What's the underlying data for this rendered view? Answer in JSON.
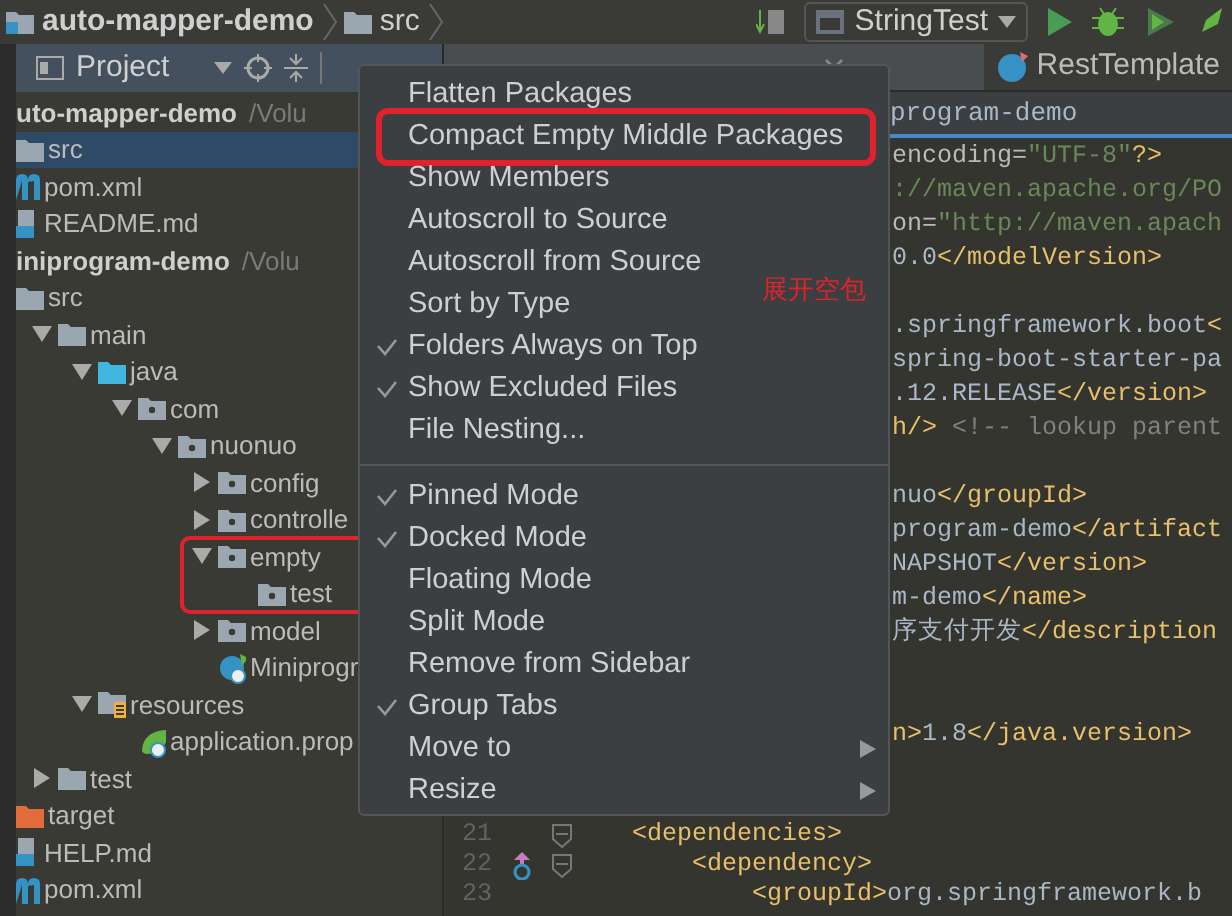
{
  "toolbar": {
    "breadcrumbs": [
      "auto-mapper-demo",
      "src"
    ],
    "run_configuration": "StringTest"
  },
  "tool_window": {
    "title": "Project",
    "tree": [
      {
        "label": "uto-mapper-demo",
        "kind": "module",
        "path": "/Volu",
        "selected": false,
        "expanded": true,
        "children": [
          {
            "label": "src",
            "kind": "folder",
            "selected": true
          },
          {
            "label": "pom.xml",
            "kind": "maven",
            "selected": false
          },
          {
            "label": "README.md",
            "kind": "markdown",
            "selected": false
          }
        ]
      },
      {
        "label": "iniprogram-demo",
        "kind": "module",
        "path": "/Volu",
        "selected": false,
        "expanded": true,
        "children": [
          {
            "label": "src",
            "kind": "folder",
            "selected": false,
            "expanded": true,
            "children": [
              {
                "label": "main",
                "kind": "folder",
                "selected": false,
                "expanded": true,
                "children": [
                  {
                    "label": "java",
                    "kind": "source",
                    "selected": false,
                    "expanded": true,
                    "children": [
                      {
                        "label": "com",
                        "kind": "package",
                        "selected": false,
                        "expanded": true,
                        "children": [
                          {
                            "label": "nuonuo",
                            "kind": "package",
                            "selected": false,
                            "expanded": true,
                            "children": [
                              {
                                "label": "config",
                                "kind": "package",
                                "selected": false,
                                "expanded": false
                              },
                              {
                                "label": "controlle",
                                "kind": "package",
                                "selected": false,
                                "expanded": false
                              },
                              {
                                "label": "empty",
                                "kind": "package",
                                "selected": false,
                                "expanded": true,
                                "annotated": true,
                                "children": [
                                  {
                                    "label": "test",
                                    "kind": "package",
                                    "selected": false
                                  }
                                ]
                              },
                              {
                                "label": "model",
                                "kind": "package",
                                "selected": false,
                                "expanded": false
                              },
                              {
                                "label": "Miniprogr",
                                "kind": "boot-class",
                                "selected": false
                              }
                            ]
                          }
                        ]
                      }
                    ]
                  },
                  {
                    "label": "resources",
                    "kind": "resources",
                    "selected": false,
                    "expanded": true,
                    "children": [
                      {
                        "label": "application.prop",
                        "kind": "properties",
                        "selected": false
                      }
                    ]
                  }
                ]
              },
              {
                "label": "test",
                "kind": "folder",
                "selected": false,
                "expanded": false
              }
            ]
          },
          {
            "label": "target",
            "kind": "excluded",
            "selected": false
          },
          {
            "label": "HELP.md",
            "kind": "markdown",
            "selected": false
          },
          {
            "label": "pom.xml",
            "kind": "maven",
            "selected": false
          }
        ]
      }
    ]
  },
  "editor": {
    "tabs": [
      {
        "selected": true,
        "closable": true
      },
      {
        "label": "RestTemplate",
        "selected": false,
        "closable": false
      }
    ],
    "breadcrumb": "program-demo",
    "lines": [
      {
        "kind": "partial",
        "segments": [
          {
            "text": "encoding=",
            "kind": "attr"
          },
          {
            "text": "\"UTF-8\"",
            "kind": "value"
          },
          {
            "text": "?>",
            "kind": "tag"
          }
        ]
      },
      {
        "kind": "partial",
        "segments": [
          {
            "text": "://maven.apache.org/PO",
            "kind": "value"
          }
        ]
      },
      {
        "kind": "partial",
        "segments": [
          {
            "text": "on=",
            "kind": "attr"
          },
          {
            "text": "\"http://maven.apach",
            "kind": "value"
          }
        ]
      },
      {
        "kind": "partial",
        "segments": [
          {
            "text": "0.0",
            "kind": "text"
          },
          {
            "text": "</modelVersion>",
            "kind": "tag"
          }
        ]
      },
      {
        "kind": "blank"
      },
      {
        "kind": "partial",
        "segments": [
          {
            "text": ".springframework.boot",
            "kind": "text"
          },
          {
            "text": "<",
            "kind": "tag"
          }
        ]
      },
      {
        "kind": "partial",
        "segments": [
          {
            "text": "spring-boot-starter-pa",
            "kind": "text"
          }
        ]
      },
      {
        "kind": "partial",
        "segments": [
          {
            "text": ".12.RELEASE",
            "kind": "text"
          },
          {
            "text": "</version>",
            "kind": "tag"
          }
        ]
      },
      {
        "kind": "partial",
        "segments": [
          {
            "text": "h/>",
            "kind": "tag"
          },
          {
            "text": " <!-- lookup parent",
            "kind": "comment"
          }
        ]
      },
      {
        "kind": "blank"
      },
      {
        "kind": "partial",
        "segments": [
          {
            "text": "nuo",
            "kind": "text"
          },
          {
            "text": "</groupId>",
            "kind": "tag"
          }
        ]
      },
      {
        "kind": "partial",
        "segments": [
          {
            "text": "program-demo",
            "kind": "text"
          },
          {
            "text": "</artifact",
            "kind": "tag"
          }
        ]
      },
      {
        "kind": "partial",
        "segments": [
          {
            "text": "NAPSHOT",
            "kind": "text"
          },
          {
            "text": "</version>",
            "kind": "tag"
          }
        ]
      },
      {
        "kind": "partial",
        "segments": [
          {
            "text": "m-demo",
            "kind": "text"
          },
          {
            "text": "</name>",
            "kind": "tag"
          }
        ]
      },
      {
        "kind": "partial",
        "segments": [
          {
            "text": "序支付开发",
            "kind": "text"
          },
          {
            "text": "</description",
            "kind": "tag"
          }
        ]
      },
      {
        "kind": "blank"
      },
      {
        "kind": "blank"
      },
      {
        "kind": "partial",
        "segments": [
          {
            "text": "n>",
            "kind": "tag"
          },
          {
            "text": "1.8",
            "kind": "text"
          },
          {
            "text": "</java.version>",
            "kind": "tag"
          }
        ]
      },
      {
        "kind": "blank"
      },
      {
        "kind": "blank"
      },
      {
        "kind": "full",
        "number": "21",
        "fold": true,
        "override": false,
        "segments": [
          {
            "text": "<dependencies>",
            "kind": "tag"
          }
        ]
      },
      {
        "kind": "full",
        "number": "22",
        "fold": true,
        "override": true,
        "segments": [
          {
            "text": "    <dependency>",
            "kind": "tag"
          }
        ]
      },
      {
        "kind": "full",
        "number": "23",
        "fold": false,
        "override": false,
        "segments": [
          {
            "text": "        <groupId>",
            "kind": "tag"
          },
          {
            "text": "org.springframework.b",
            "kind": "text"
          }
        ]
      }
    ]
  },
  "context_menu": {
    "groups": [
      [
        {
          "label": "Flatten Packages",
          "checked": false,
          "submenu": false
        },
        {
          "label": "Compact Empty Middle Packages",
          "checked": false,
          "submenu": false,
          "annotated": true
        },
        {
          "label": "Show Members",
          "checked": false,
          "submenu": false
        },
        {
          "label": "Autoscroll to Source",
          "checked": false,
          "submenu": false
        },
        {
          "label": "Autoscroll from Source",
          "checked": false,
          "submenu": false
        },
        {
          "label": "Sort by Type",
          "checked": false,
          "submenu": false
        },
        {
          "label": "Folders Always on Top",
          "checked": true,
          "submenu": false
        },
        {
          "label": "Show Excluded Files",
          "checked": true,
          "submenu": false
        },
        {
          "label": "File Nesting...",
          "checked": false,
          "submenu": false
        }
      ],
      [
        {
          "label": "Pinned Mode",
          "checked": true,
          "submenu": false
        },
        {
          "label": "Docked Mode",
          "checked": true,
          "submenu": false
        },
        {
          "label": "Floating Mode",
          "checked": false,
          "submenu": false
        },
        {
          "label": "Split Mode",
          "checked": false,
          "submenu": false
        },
        {
          "label": "Remove from Sidebar",
          "checked": false,
          "submenu": false
        },
        {
          "label": "Group Tabs",
          "checked": true,
          "submenu": false
        },
        {
          "label": "Move to",
          "checked": false,
          "submenu": true
        },
        {
          "label": "Resize",
          "checked": false,
          "submenu": true
        }
      ]
    ]
  },
  "annotation": {
    "text": "展开空包"
  }
}
